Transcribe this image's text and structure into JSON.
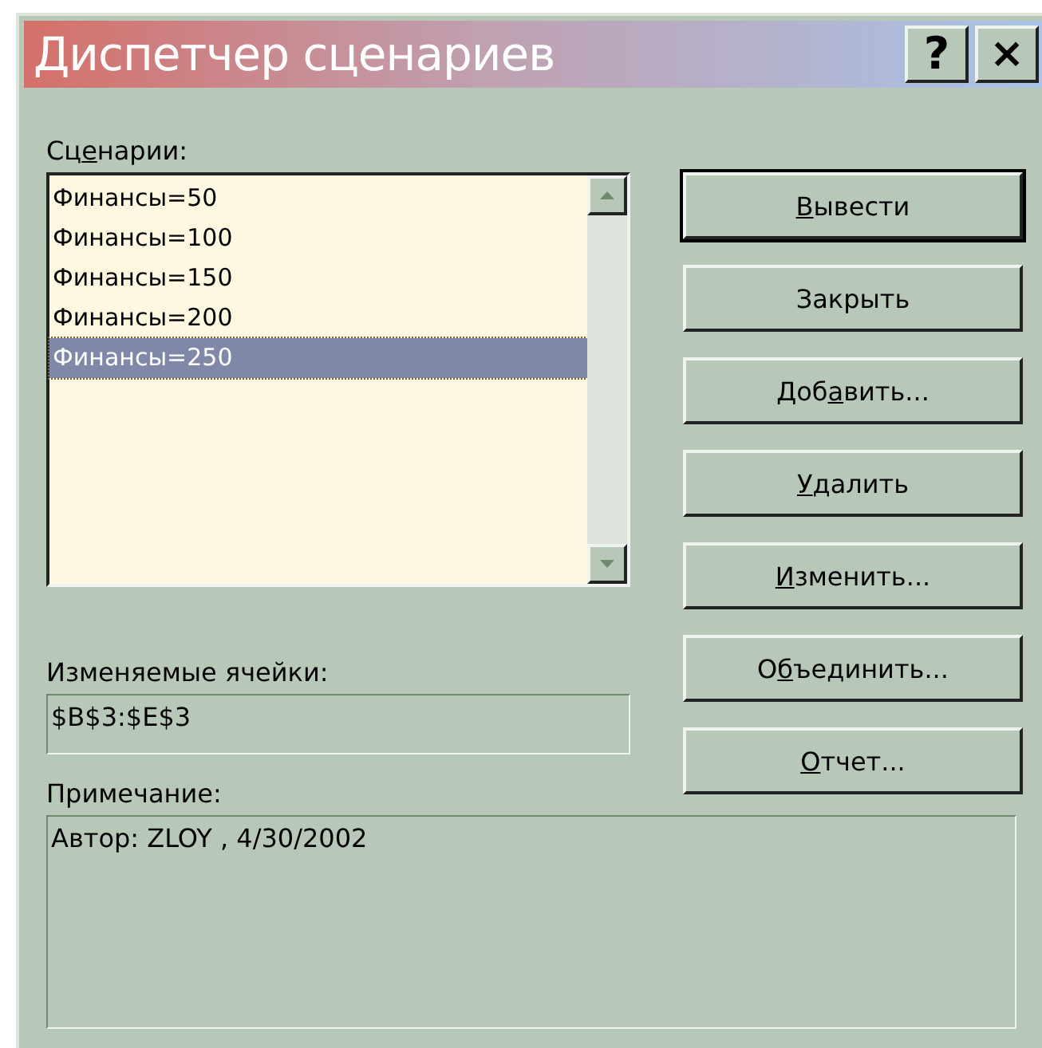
{
  "window": {
    "title": "Диспетчер сценариев",
    "controls": [
      {
        "kind": "help",
        "label": "?"
      },
      {
        "kind": "close",
        "label": "×"
      }
    ]
  },
  "scenarios": {
    "label": [
      {
        "text": "Сц",
        "underlined": false
      },
      {
        "text": "е",
        "underlined": true
      },
      {
        "text": "нарии:",
        "underlined": false
      }
    ],
    "items": [
      {
        "label": "Финансы=50",
        "selected": false
      },
      {
        "label": "Финансы=100",
        "selected": false
      },
      {
        "label": "Финансы=150",
        "selected": false
      },
      {
        "label": "Финансы=200",
        "selected": false
      },
      {
        "label": "Финансы=250",
        "selected": true
      }
    ]
  },
  "changing_cells": {
    "label": "Изменяемые ячейки:",
    "value": "$B$3:$E$3"
  },
  "comment": {
    "label": "Примечание:",
    "value": "Автор: ZLOY , 4/30/2002"
  },
  "buttons": [
    {
      "label": [
        {
          "text": "В",
          "underlined": true
        },
        {
          "text": "ывести",
          "underlined": false
        }
      ],
      "default": true
    },
    {
      "label": [
        {
          "text": "Закрыть",
          "underlined": false
        }
      ],
      "default": false
    },
    {
      "label": [
        {
          "text": "Доб",
          "underlined": false
        },
        {
          "text": "а",
          "underlined": true
        },
        {
          "text": "вить...",
          "underlined": false
        }
      ],
      "default": false
    },
    {
      "label": [
        {
          "text": "У",
          "underlined": true
        },
        {
          "text": "далить",
          "underlined": false
        }
      ],
      "default": false
    },
    {
      "label": [
        {
          "text": "И",
          "underlined": true
        },
        {
          "text": "зменить...",
          "underlined": false
        }
      ],
      "default": false
    },
    {
      "label": [
        {
          "text": "О",
          "underlined": false
        },
        {
          "text": "б",
          "underlined": true
        },
        {
          "text": "ъединить...",
          "underlined": false
        }
      ],
      "default": false
    },
    {
      "label": [
        {
          "text": "О",
          "underlined": true
        },
        {
          "text": "тчет...",
          "underlined": false
        }
      ],
      "default": false
    }
  ]
}
